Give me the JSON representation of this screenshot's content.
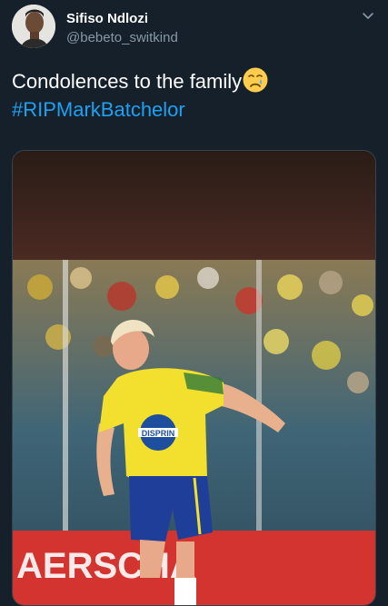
{
  "tweet": {
    "author_name": "Sifiso Ndlozi",
    "author_handle": "@bebeto_switkind",
    "text": "Condolences to the family",
    "hashtag": "#RIPMarkBatchelor",
    "emoji": "crying-face-emoji"
  },
  "media": {
    "sponsor_text": "DISPRIN",
    "banner_text": "AERSCHA"
  },
  "icons": {
    "menu": "chevron-down-icon",
    "avatar": "profile-photo"
  },
  "colors": {
    "background": "#15202b",
    "link": "#1da1f2",
    "secondary_text": "#8899a6",
    "jersey_yellow": "#f2df2e",
    "shorts_blue": "#1e3e9a"
  }
}
